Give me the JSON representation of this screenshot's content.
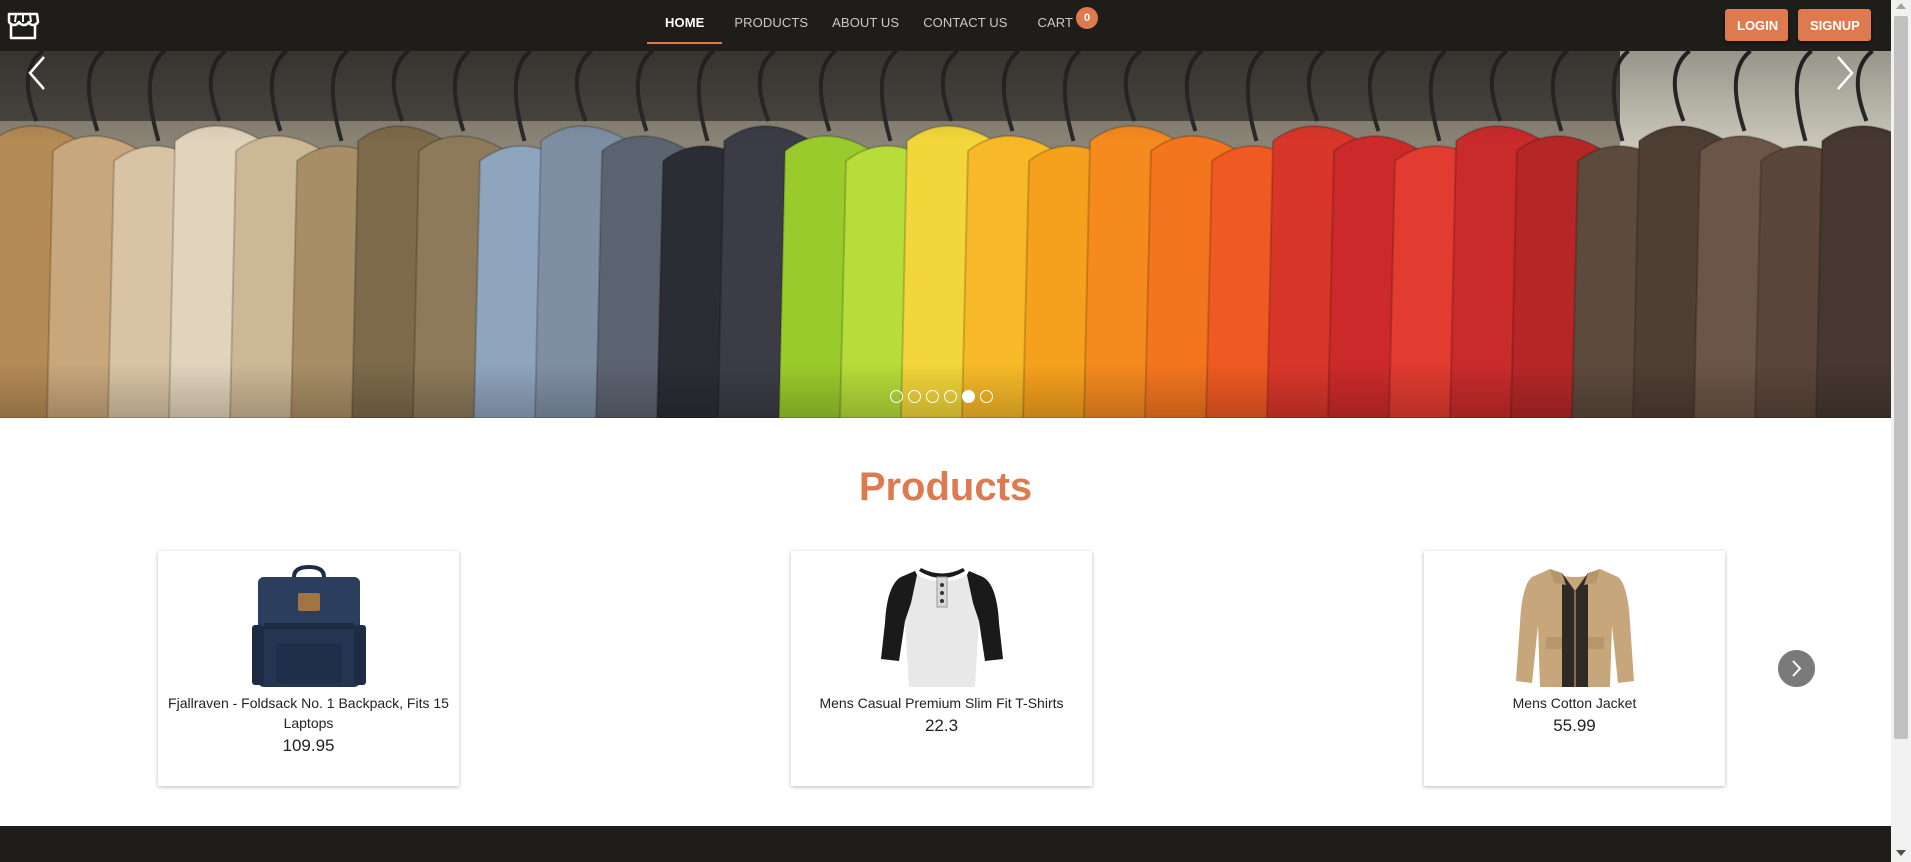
{
  "nav": {
    "logo_icon": "storefront-icon",
    "links": {
      "home": "HOME",
      "products": "PRODUCTS",
      "about": "ABOUT US",
      "contact": "CONTACT US",
      "cart": "CART"
    },
    "cart_count": "0",
    "login": "LOGIN",
    "signup": "SIGNUP",
    "active_link": "HOME"
  },
  "hero": {
    "image": "clothes-on-hangers",
    "slide_count": 6,
    "active_slide": 5,
    "prev_icon": "chevron-left-icon",
    "next_icon": "chevron-right-icon"
  },
  "products": {
    "heading": "Products",
    "items": [
      {
        "title": "Fjallraven - Foldsack No. 1 Backpack, Fits 15 Laptops",
        "price": "109.95",
        "image": "backpack-image"
      },
      {
        "title": "Mens Casual Premium Slim Fit T-Shirts",
        "price": "22.3",
        "image": "tshirt-image"
      },
      {
        "title": "Mens Cotton Jacket",
        "price": "55.99",
        "image": "jacket-image"
      }
    ],
    "next_icon": "chevron-right-icon"
  },
  "colors": {
    "accent": "#de7a4f",
    "navbar": "#1f1d1a",
    "footer": "#1f1d1a"
  }
}
